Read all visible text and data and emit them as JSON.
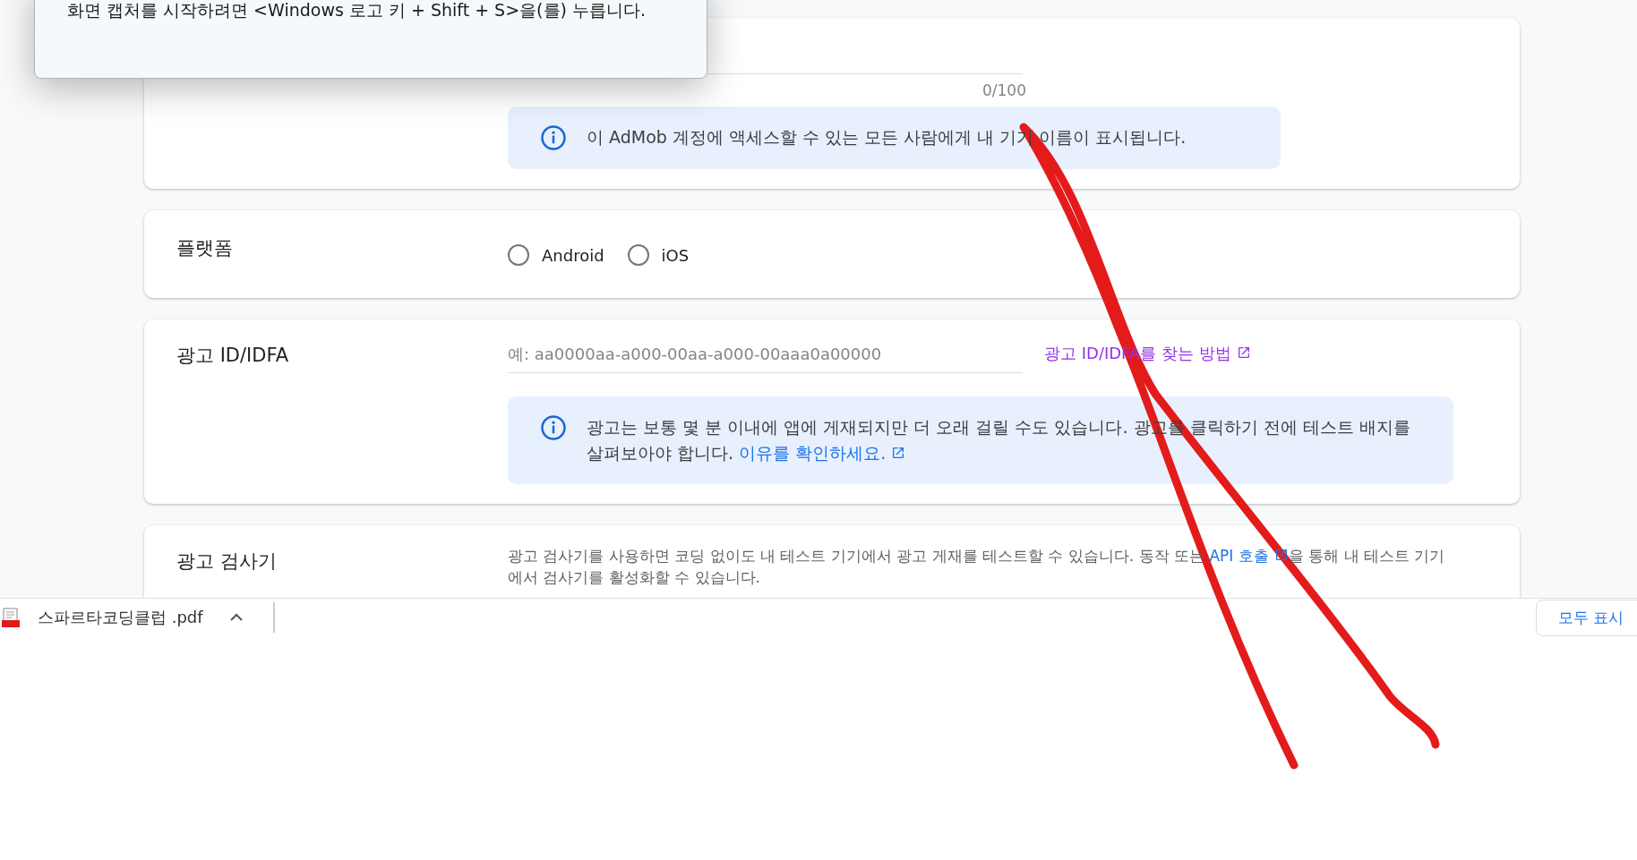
{
  "snip_popup": {
    "text": "화면 캡처를 시작하려면 <Windows 로고 키 + Shift + S>을(를) 누릅니다."
  },
  "cards": [
    {
      "kind": "name",
      "counter": "0/100",
      "info": "이 AdMob 계정에 액세스할 수 있는 모든 사람에게 내 기기 이름이 표시됩니다."
    },
    {
      "kind": "platform",
      "label": "플랫폼",
      "options": [
        {
          "label": "Android",
          "selected": false
        },
        {
          "label": "iOS",
          "selected": false
        }
      ]
    },
    {
      "kind": "adid",
      "label": "광고 ID/IDFA",
      "placeholder": "예: aa0000aa-a000-00aa-a000-00aaa0a00000",
      "help_link": "광고 ID/IDFA를 찾는 방법",
      "info": "광고는 보통 몇 분 이내에 앱에 게재되지만 더 오래 걸릴 수도 있습니다. 광고를 클릭하기 전에 테스트 배지를 살펴보아야 합니다.",
      "info_link": "이유를 확인하세요."
    },
    {
      "kind": "inspector",
      "label": "광고 검사기",
      "text_before": "광고 검사기를 사용하면 코딩 없이도 내 테스트 기기에서 광고 게재를 테스트할 수 있습니다. 동작 또는",
      "link": "API 호출",
      "text_after": "을 통해 내 테스트 기기에서 검사기를 활성화할 수 있습니다."
    }
  ],
  "download_bar": {
    "file_name": "스파르타코딩클럽 .pdf",
    "show_all": "모두 표시"
  }
}
